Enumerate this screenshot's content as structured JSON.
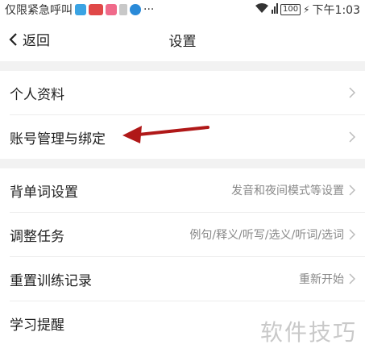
{
  "status_bar": {
    "carrier_text": "仅限紧急呼叫",
    "dots": "···",
    "battery": "100",
    "time": "下午1:03"
  },
  "nav": {
    "back_label": "返回",
    "title": "设置"
  },
  "section1": {
    "items": [
      {
        "label": "个人资料",
        "value": ""
      },
      {
        "label": "账号管理与绑定",
        "value": ""
      }
    ]
  },
  "section2": {
    "items": [
      {
        "label": "背单词设置",
        "value": "发音和夜间模式等设置"
      },
      {
        "label": "调整任务",
        "value": "例句/释义/听写/选义/听词/选词"
      },
      {
        "label": "重置训练记录",
        "value": "重新开始"
      },
      {
        "label": "学习提醒",
        "value": ""
      }
    ]
  },
  "watermark": "软件技巧",
  "colors": {
    "annotation_arrow": "#b01818",
    "section_gap": "#f2f2f2",
    "secondary_text": "#888888"
  }
}
